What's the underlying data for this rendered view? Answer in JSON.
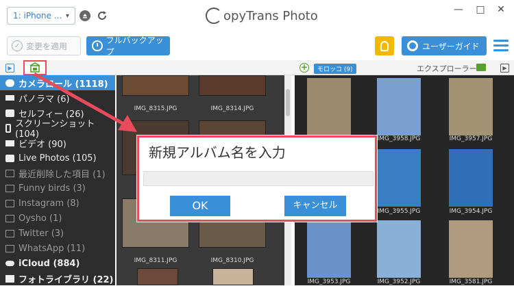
{
  "titlebar": {
    "device_label": "1: iPhone ...",
    "app_title_prefix": "C",
    "app_title_rest": "opyTrans Photo",
    "minimize": "—",
    "maximize": "□",
    "close": "✕"
  },
  "toolbar": {
    "apply_label": "変更を適用",
    "backup_label": "フルバックアップ",
    "guide_label": "ユーザーガイド"
  },
  "subbar": {
    "album_tag": "モロッコ (9)",
    "explorer_label": "エクスプローラー"
  },
  "sidebar": {
    "items": [
      {
        "label": "カメラロール (1118)",
        "icon": "camera-roll-icon",
        "state": "selected"
      },
      {
        "label": "パノラマ (6)",
        "icon": "panorama-icon",
        "state": "normal"
      },
      {
        "label": "セルフィー (26)",
        "icon": "selfie-icon",
        "state": "normal"
      },
      {
        "label": "スクリーンショット (104)",
        "icon": "screenshot-icon",
        "state": "normal"
      },
      {
        "label": "ビデオ (90)",
        "icon": "video-icon",
        "state": "normal"
      },
      {
        "label": "Live Photos (105)",
        "icon": "live-photos-icon",
        "state": "normal"
      },
      {
        "label": "最近削除した項目 (1)",
        "icon": "album-icon",
        "state": "dim"
      },
      {
        "label": "Funny birds (3)",
        "icon": "album-icon",
        "state": "dim"
      },
      {
        "label": "Instagram (8)",
        "icon": "album-icon",
        "state": "dim"
      },
      {
        "label": "Oysho (1)",
        "icon": "album-icon",
        "state": "dim"
      },
      {
        "label": "Twitter (3)",
        "icon": "album-icon",
        "state": "dim"
      },
      {
        "label": "WhatsApp (11)",
        "icon": "album-icon",
        "state": "dim"
      },
      {
        "label": "iCloud (884)",
        "icon": "cloud-icon",
        "state": "bold"
      },
      {
        "label": "フォトライブラリ (22)",
        "icon": "photo-library-icon",
        "state": "bold"
      }
    ]
  },
  "middle": {
    "captions": [
      "IMG_8315.JPG",
      "IMG_8314.JPG",
      "IMG_8311.JPG",
      "IMG_8310.JPG"
    ]
  },
  "right": {
    "captions": [
      "IMG_3958.JPG",
      "IMG_3957.JPG",
      "IMG_3955.JPG",
      "IMG_3954.JPG",
      "IMG_3953.JPG",
      "IMG_3952.JPG",
      "IMG_3581.JPG"
    ]
  },
  "dialog": {
    "title": "新規アルバム名を入力",
    "input_value": "",
    "ok_label": "OK",
    "cancel_label": "キャンセル"
  },
  "colors": {
    "accent": "#3a8fd6",
    "sidebar_bg": "#2d2d2d",
    "highlight": "#e84b5b",
    "bulb": "#f5b800"
  }
}
